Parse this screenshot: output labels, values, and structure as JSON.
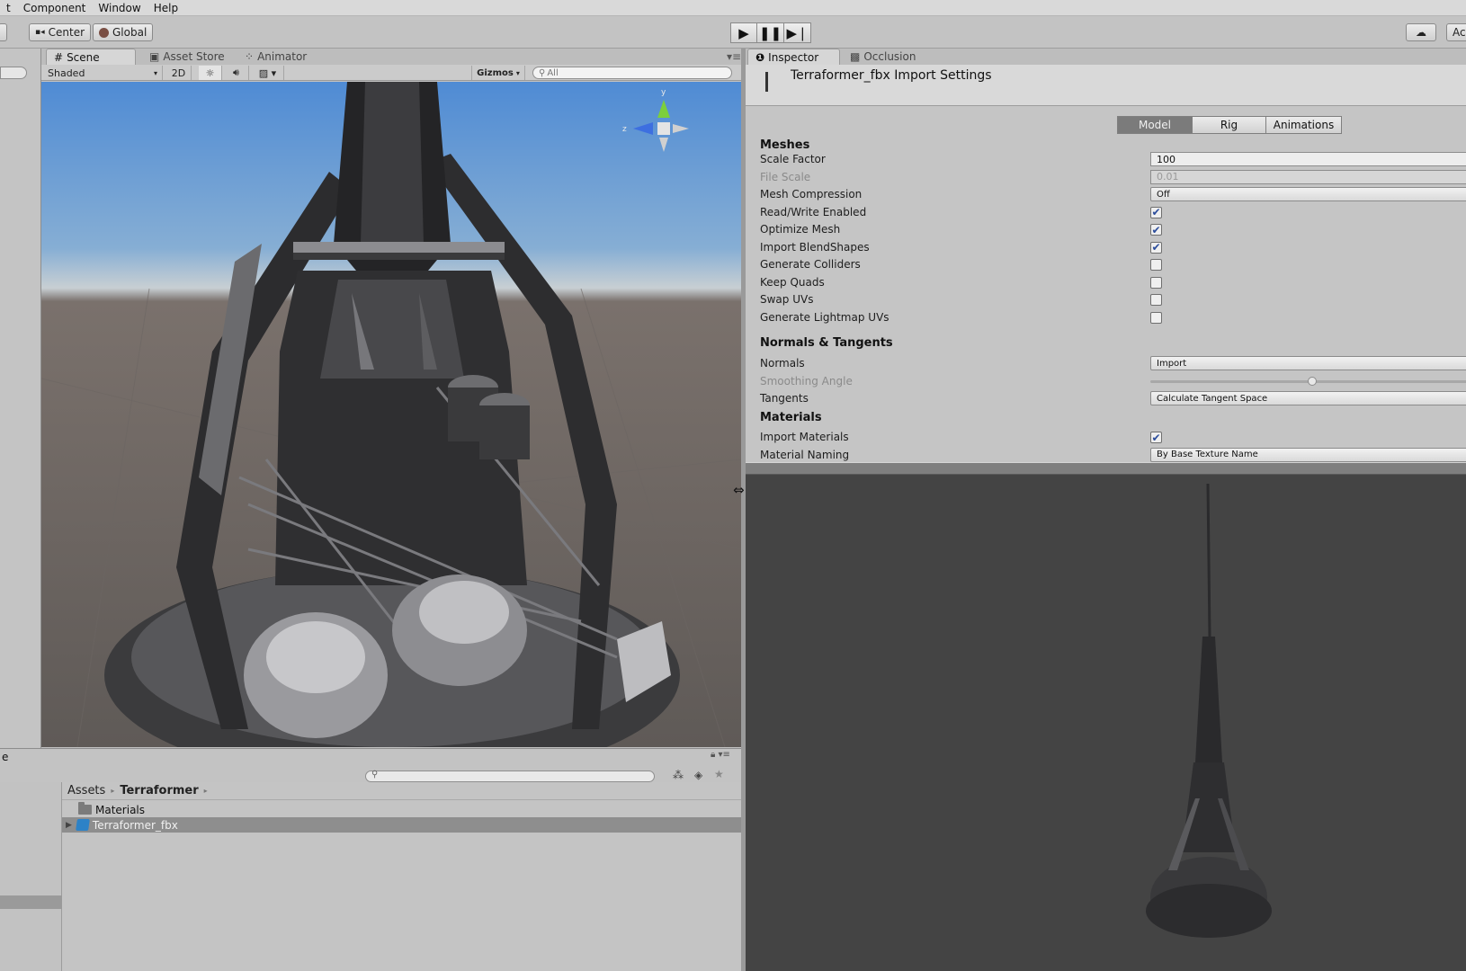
{
  "menu": [
    "t",
    "Component",
    "Window",
    "Help"
  ],
  "toolbar": {
    "pivot_label": "Center",
    "space_label": "Global",
    "account_label": "Acc",
    "play_icon": "play-icon",
    "pause_icon": "pause-icon",
    "step_icon": "step-icon",
    "cloud_icon": "cloud-icon"
  },
  "scene": {
    "tabs": [
      "Scene",
      "Asset Store",
      "Animator"
    ],
    "shading_mode": "Shaded",
    "mode_2d": "2D",
    "gizmos_label": "Gizmos",
    "search_placeholder": "All",
    "axis_labels": {
      "y": "y",
      "z": "z"
    }
  },
  "project": {
    "panel_label": "e",
    "breadcrumb": [
      "Assets",
      "Terraformer"
    ],
    "items": [
      {
        "label": "Materials",
        "type": "folder",
        "selected": false
      },
      {
        "label": "Terraformer_fbx",
        "type": "model",
        "selected": true
      }
    ]
  },
  "inspector": {
    "tabs": [
      "Inspector",
      "Occlusion"
    ],
    "title": "Terraformer_fbx Import Settings",
    "subtabs": [
      "Model",
      "Rig",
      "Animations"
    ],
    "active_subtab": "Model",
    "meshes_header": "Meshes",
    "rows_meshes": [
      {
        "label": "Scale Factor",
        "kind": "field",
        "value": "100"
      },
      {
        "label": "File Scale",
        "kind": "field-dim",
        "value": "0.01"
      },
      {
        "label": "Mesh Compression",
        "kind": "dropdown",
        "value": "Off"
      },
      {
        "label": "Read/Write Enabled",
        "kind": "check",
        "checked": true
      },
      {
        "label": "Optimize Mesh",
        "kind": "check",
        "checked": true
      },
      {
        "label": "Import BlendShapes",
        "kind": "check",
        "checked": true
      },
      {
        "label": "Generate Colliders",
        "kind": "check",
        "checked": false
      },
      {
        "label": "Keep Quads",
        "kind": "check",
        "checked": false
      },
      {
        "label": "Swap UVs",
        "kind": "check",
        "checked": false
      },
      {
        "label": "Generate Lightmap UVs",
        "kind": "check",
        "checked": false
      }
    ],
    "normals_header": "Normals & Tangents",
    "rows_normals": [
      {
        "label": "Normals",
        "kind": "dropdown",
        "value": "Import"
      },
      {
        "label": "Smoothing Angle",
        "kind": "slider",
        "level": 0.5
      },
      {
        "label": "Tangents",
        "kind": "dropdown",
        "value": "Calculate Tangent Space"
      }
    ],
    "materials_header": "Materials",
    "rows_materials": [
      {
        "label": "Import Materials",
        "kind": "check",
        "checked": true
      },
      {
        "label": "Material Naming",
        "kind": "dropdown",
        "value": "By Base Texture Name"
      }
    ]
  }
}
